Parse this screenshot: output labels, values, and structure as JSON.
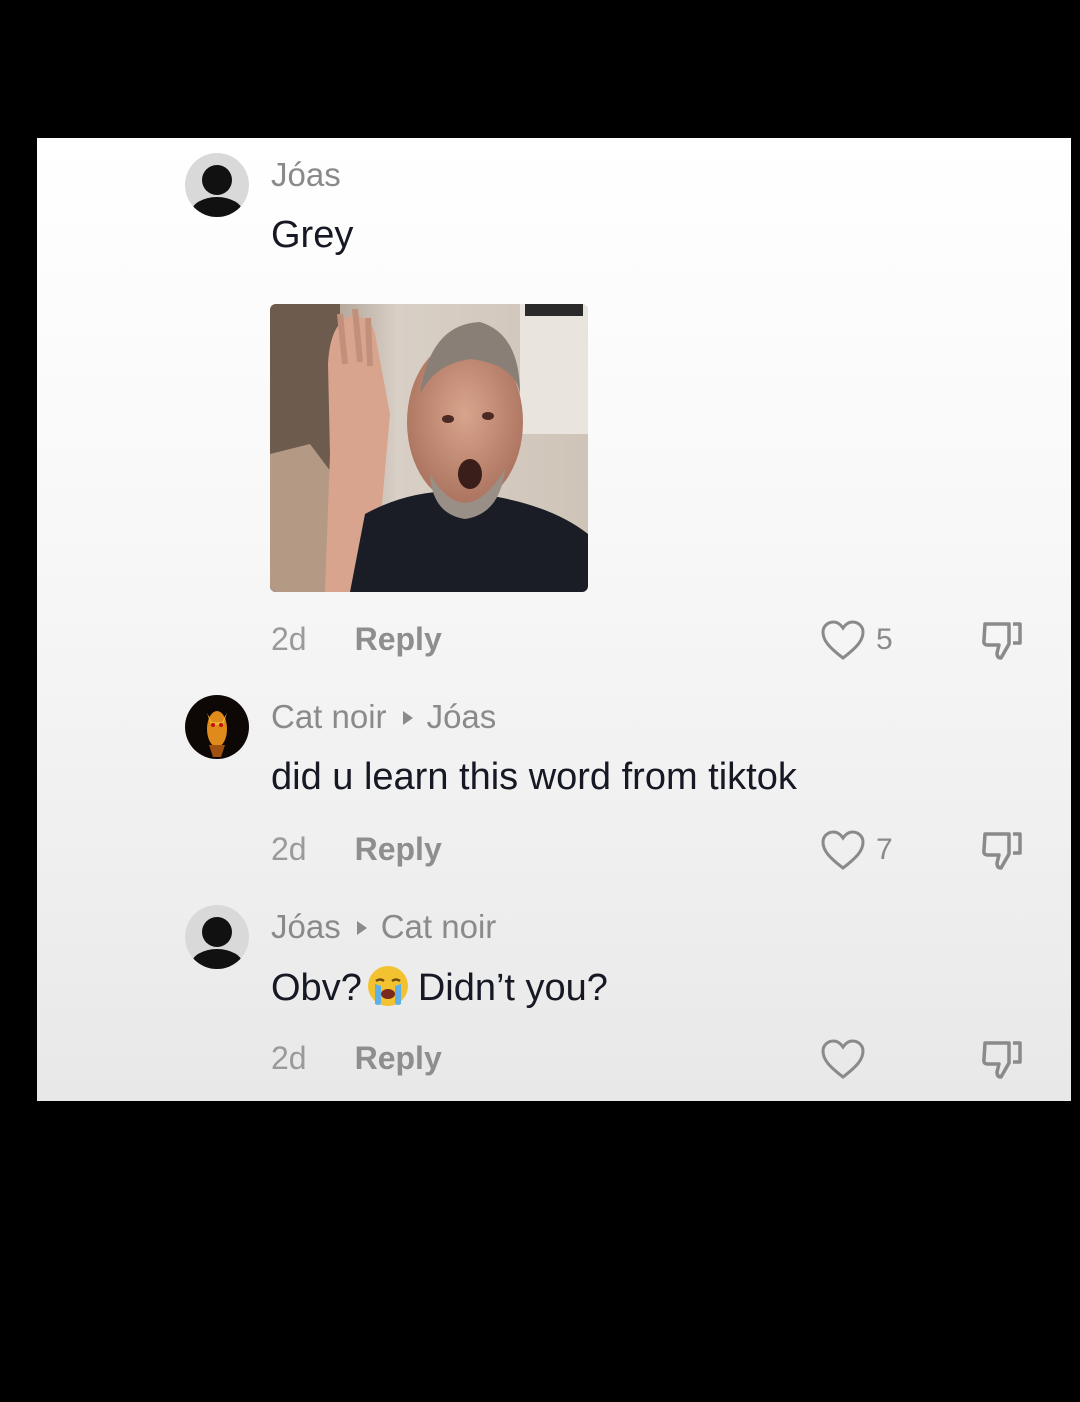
{
  "comments": [
    {
      "author": "Jóas",
      "text": "Grey",
      "time": "2d",
      "reply_label": "Reply",
      "likes": "5"
    },
    {
      "author": "Cat noir",
      "reply_to": "Jóas",
      "text": "did u learn this word from tiktok",
      "time": "2d",
      "reply_label": "Reply",
      "likes": "7"
    },
    {
      "author": "Jóas",
      "reply_to": "Cat noir",
      "text_before": "Obv?",
      "emoji": "crying-face-emoji",
      "text_after": "Didn’t you?",
      "time": "2d",
      "reply_label": "Reply",
      "likes": ""
    }
  ],
  "colors": {
    "background": "#000000",
    "panel": "#ffffff",
    "author": "#8a8a8a",
    "text": "#161823"
  }
}
